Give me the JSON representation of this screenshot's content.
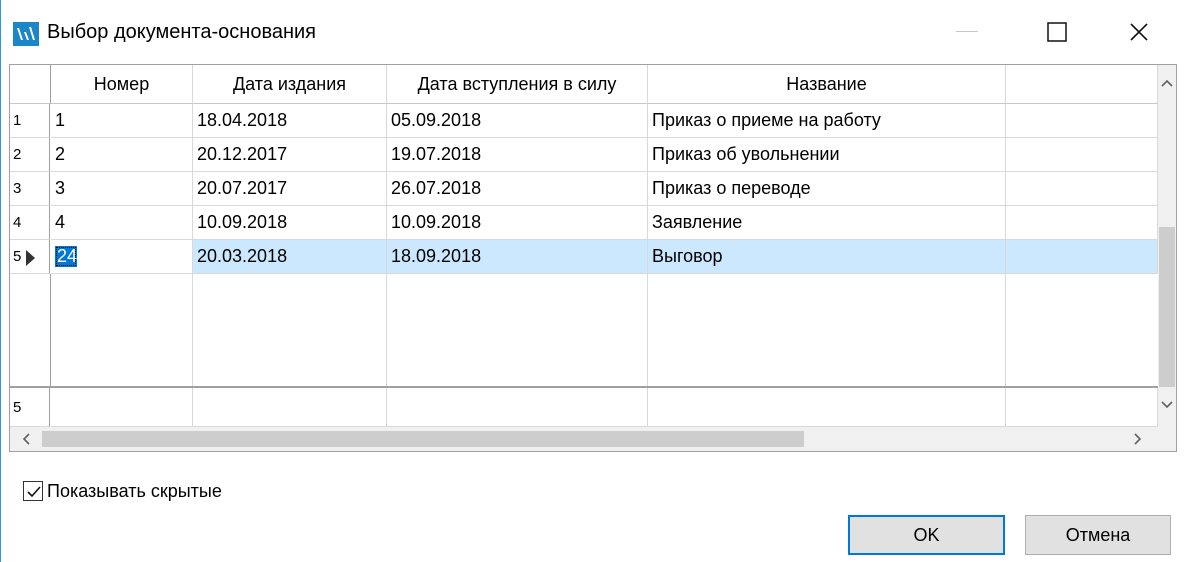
{
  "window": {
    "title": "Выбор документа-основания",
    "accent_color": "#1ba1e2",
    "icon": "app-logo-icon"
  },
  "grid": {
    "columns": [
      "Номер",
      "Дата издания",
      "Дата вступления в силу",
      "Название",
      ""
    ],
    "rows": [
      {
        "row_num": "1",
        "number": "1",
        "issue_date": "18.04.2018",
        "effective_date": "05.09.2018",
        "name": "Приказ о приеме на работу"
      },
      {
        "row_num": "2",
        "number": "2",
        "issue_date": "20.12.2017",
        "effective_date": "19.07.2018",
        "name": "Приказ об увольнении"
      },
      {
        "row_num": "3",
        "number": "3",
        "issue_date": "20.07.2017",
        "effective_date": "26.07.2018",
        "name": "Приказ о переводе"
      },
      {
        "row_num": "4",
        "number": "4",
        "issue_date": "10.09.2018",
        "effective_date": "10.09.2018",
        "name": "Заявление"
      },
      {
        "row_num": "5",
        "number": "24",
        "issue_date": "20.03.2018",
        "effective_date": "18.09.2018",
        "name": "Выговор"
      }
    ],
    "selected_row": 5,
    "selected_color": "#cce8ff",
    "focus_color": "#0078d7",
    "new_row_num": "5"
  },
  "options": {
    "show_hidden_label": "Показывать скрытые",
    "show_hidden_checked": true
  },
  "buttons": {
    "ok_label": "OK",
    "cancel_label": "Отмена"
  }
}
